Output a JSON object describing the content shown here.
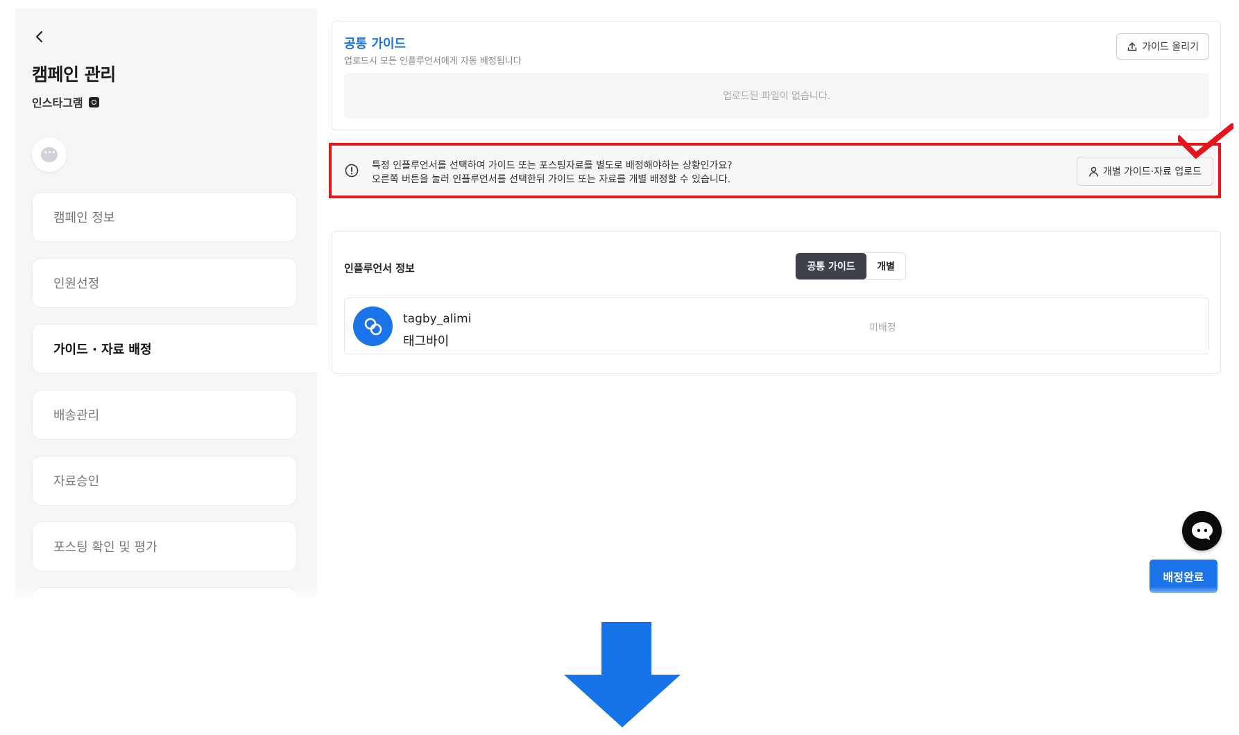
{
  "sidebar": {
    "title": "캠페인 관리",
    "channel": "인스타그램",
    "menu": [
      {
        "label": "캠페인 정보"
      },
      {
        "label": "인원선정"
      },
      {
        "label": "가이드 · 자료 배정"
      },
      {
        "label": "배송관리"
      },
      {
        "label": "자료승인"
      },
      {
        "label": "포스팅 확인 및 평가"
      }
    ]
  },
  "common_guide": {
    "title": "공통 가이드",
    "description": "업로드시 모든 인플루언서에게 자동 배정됩니다",
    "upload_button": "가이드 올리기",
    "empty_text": "업로드된 파일이 없습니다."
  },
  "notice": {
    "line1": "특정 인플루언서를 선택하여 가이드 또는 포스팅자료를 별도로 배정해야하는 상황인가요?",
    "line2": "오른쪽 버튼을 눌러 인플루언서를 선택한뒤 가이드 또는 자료를 개별 배정할 수 있습니다.",
    "button": "개별 가이드·자료 업로드",
    "highlight_color": "#e8141c"
  },
  "influencer_section": {
    "title": "인플루언서 정보",
    "toggle": {
      "options": [
        "공통 가이드",
        "개별"
      ],
      "selected": "공통 가이드"
    },
    "rows": [
      {
        "handle": "tagby_alimi",
        "name": "태그바이",
        "status": "미배정"
      }
    ]
  },
  "actions": {
    "complete_button": "배정완료"
  },
  "colors": {
    "accent": "#1a73e8",
    "toggle_selected": "#3d4149",
    "highlight": "#e8141c"
  }
}
